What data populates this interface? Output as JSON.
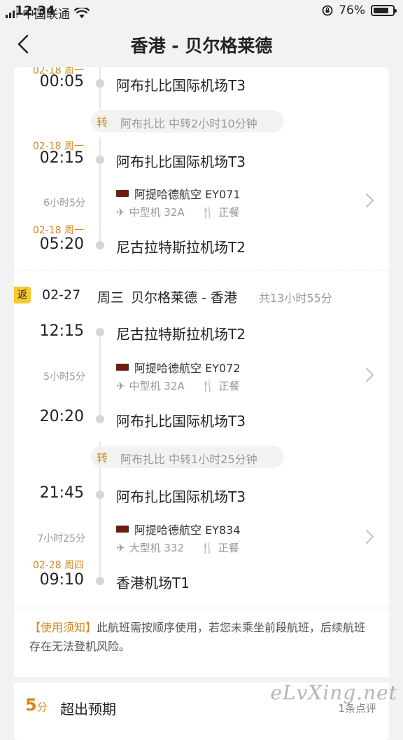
{
  "status_bar": {
    "carrier": "中国联通",
    "time": "12:34",
    "battery": "76%",
    "battery_level": 0.76
  },
  "header": {
    "title": "香港 - 贝尔格莱德"
  },
  "outbound": {
    "seg1_arrival": {
      "date": "02-18 周一",
      "time": "00:05",
      "airport": "阿布扎比国际机场T3"
    },
    "transfer": {
      "tag": "转",
      "text": "阿布扎比 中转2小时10分钟"
    },
    "seg2": {
      "dep_date": "02-18 周一",
      "dep_time": "02:15",
      "dep_airport": "阿布扎比国际机场T3",
      "duration": "6小时5分",
      "airline": "阿提哈德航空 EY071",
      "aircraft": "中型机 32A",
      "meal": "正餐",
      "arr_date": "02-18 周一",
      "arr_time": "05:20",
      "arr_airport": "尼古拉特斯拉机场T2"
    }
  },
  "return": {
    "tag": "返",
    "date": "02-27",
    "weekday": "周三",
    "route": "贝尔格莱德 - 香港",
    "total": "共13小时55分",
    "seg1": {
      "dep_time": "12:15",
      "dep_airport": "尼古拉特斯拉机场T2",
      "duration": "5小时5分",
      "airline": "阿提哈德航空 EY072",
      "aircraft": "中型机 32A",
      "meal": "正餐",
      "arr_time": "20:20",
      "arr_airport": "阿布扎比国际机场T3"
    },
    "transfer": {
      "tag": "转",
      "text": "阿布扎比 中转1小时25分钟"
    },
    "seg2": {
      "dep_time": "21:45",
      "dep_airport": "阿布扎比国际机场T3",
      "duration": "7小时25分",
      "airline": "阿提哈德航空 EY834",
      "aircraft": "大型机 332",
      "meal": "正餐",
      "arr_date": "02-28 周四",
      "arr_time": "09:10",
      "arr_airport": "香港机场T1"
    }
  },
  "notice": {
    "label": "【使用须知】",
    "text": "此航班需按顺序使用，若您未乘坐前段航班，后续航班存在无法登机风险。"
  },
  "rating": {
    "score": "5",
    "unit": "分",
    "label": "超出预期",
    "reviews": "1条点评"
  },
  "watermark": "eLvXing.net",
  "colors": {
    "accent": "#d18a1f",
    "badge": "#f7c82f"
  }
}
